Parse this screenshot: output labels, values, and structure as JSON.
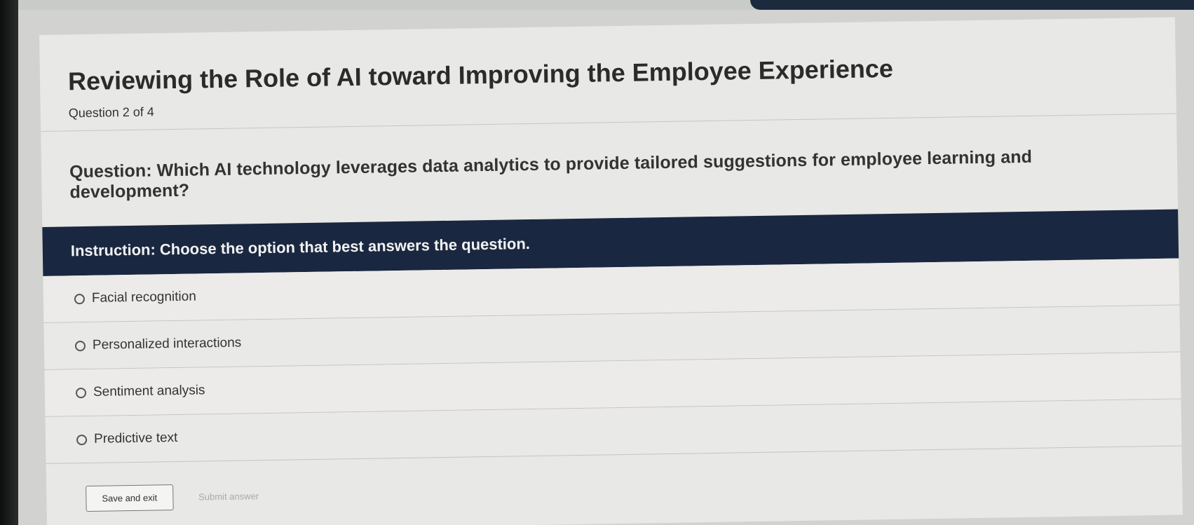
{
  "page": {
    "title": "Reviewing the Role of AI toward Improving the Employee Experience",
    "progress": "Question 2 of 4"
  },
  "question": {
    "text": "Question: Which AI technology leverages data analytics to provide tailored suggestions for employee learning and development?",
    "instruction": "Instruction: Choose the option that best answers the question."
  },
  "options": [
    {
      "label": "Facial recognition",
      "selected": false
    },
    {
      "label": "Personalized interactions",
      "selected": false
    },
    {
      "label": "Sentiment analysis",
      "selected": false
    },
    {
      "label": "Predictive text",
      "selected": false
    }
  ],
  "footer": {
    "save_label": "Save and exit",
    "submit_label": "Submit answer",
    "submit_enabled": false
  },
  "colors": {
    "instruction_bg": "#1a2740",
    "page_bg": "#e8e8e6",
    "text": "#333333"
  }
}
